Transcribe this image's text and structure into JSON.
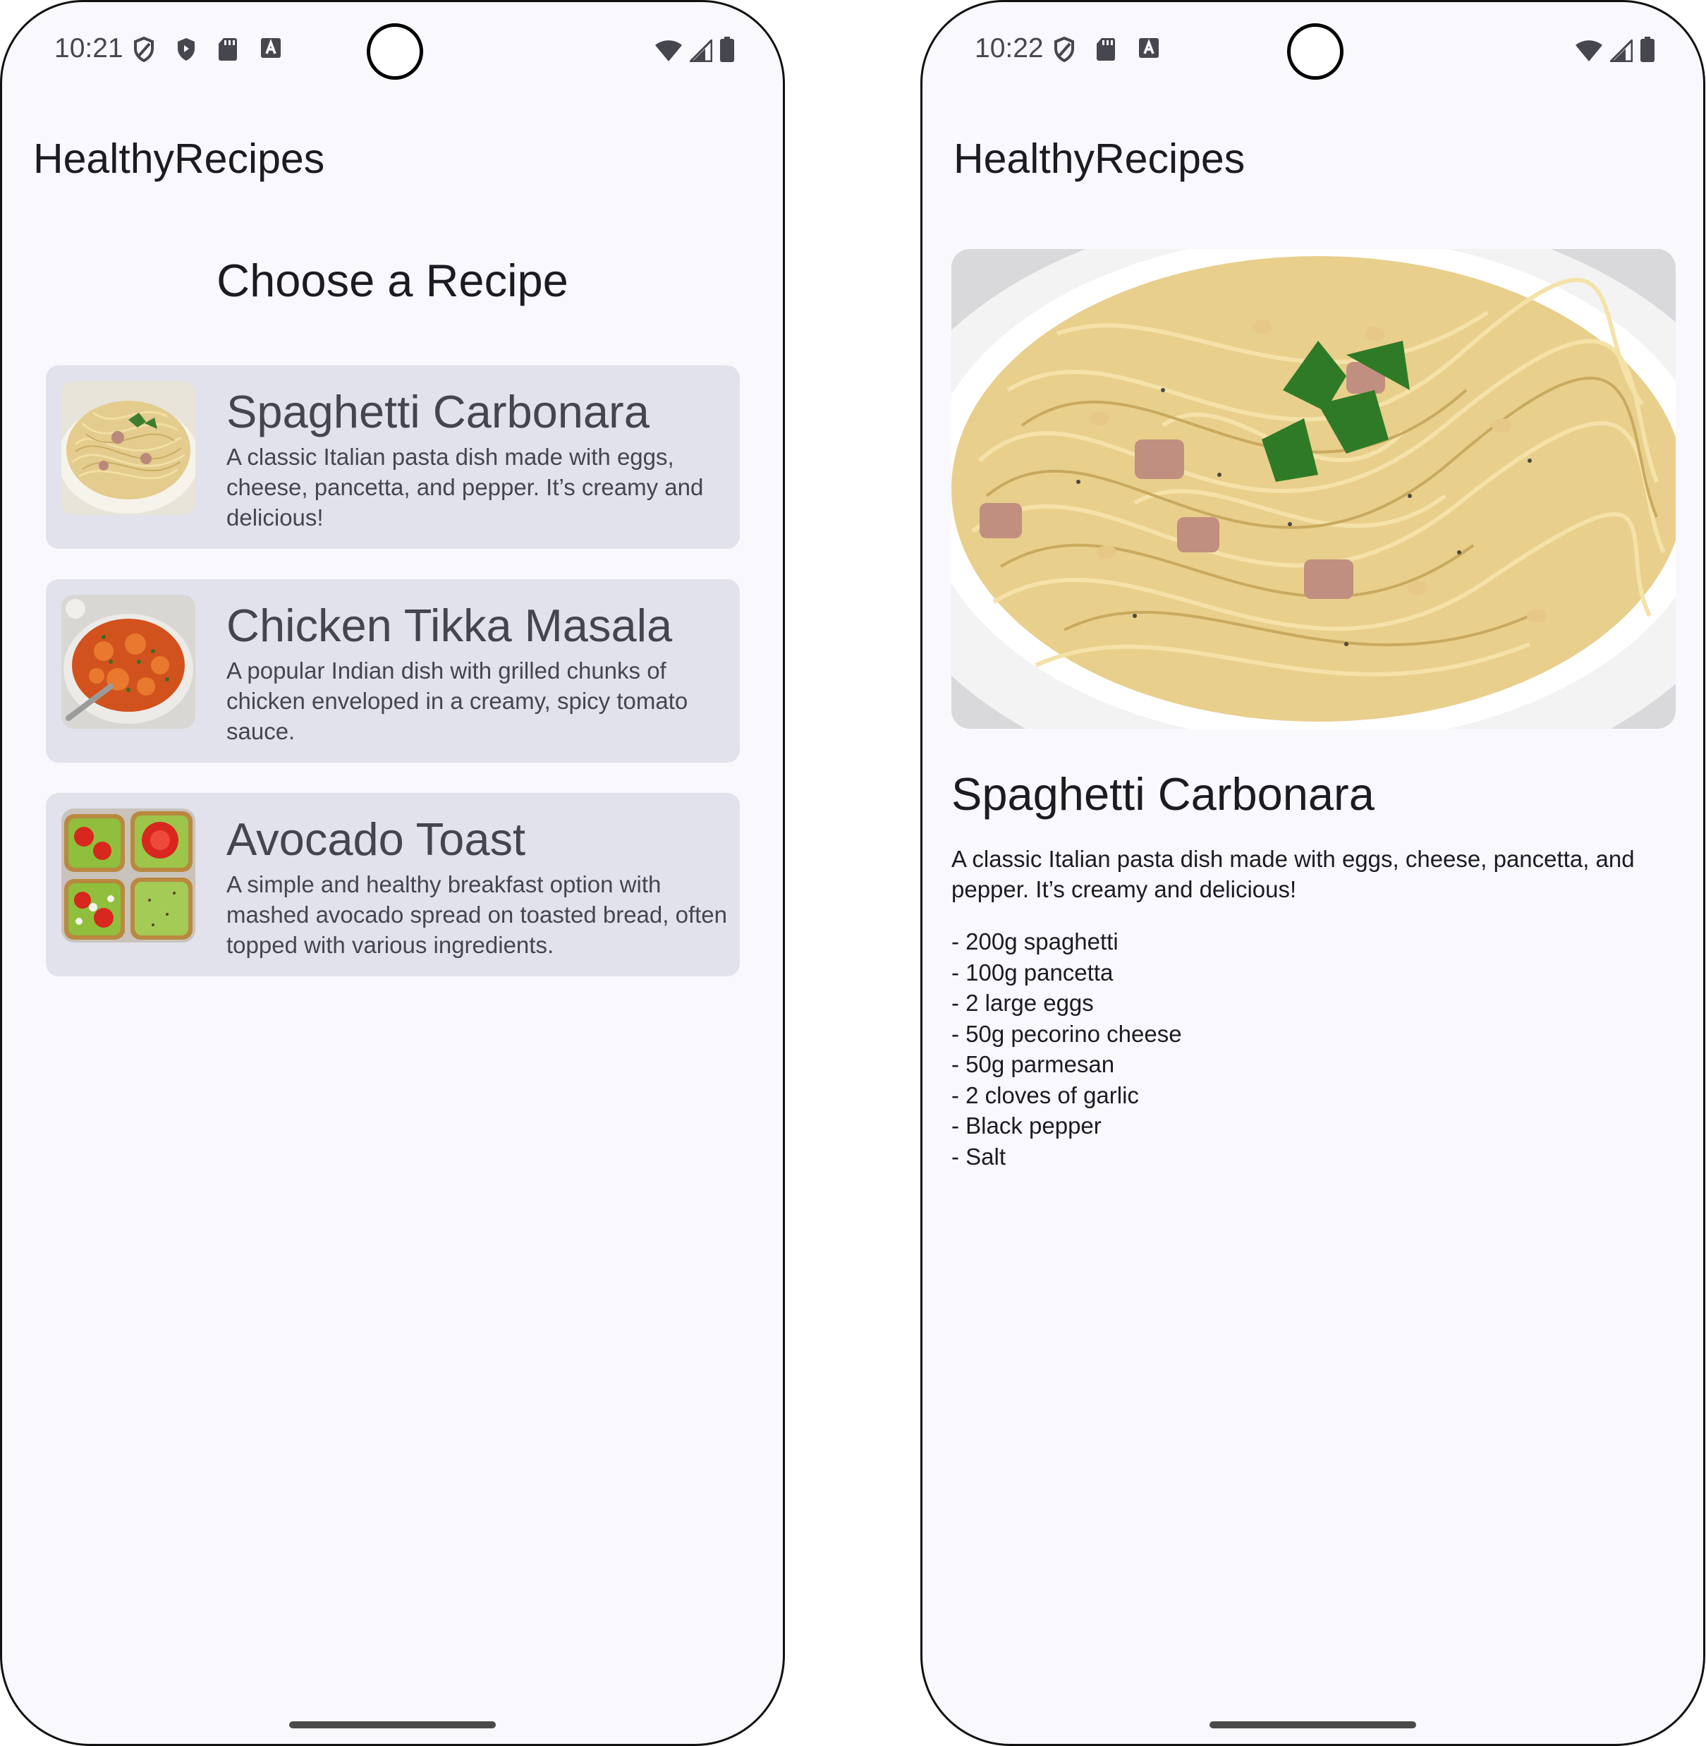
{
  "left_screen": {
    "status_bar": {
      "time": "10:21",
      "icons": [
        "shield-outline-icon",
        "shield-filled-icon",
        "sd-card-icon",
        "keyboard-a-icon",
        "wifi-icon",
        "cellular-signal-icon",
        "battery-icon"
      ]
    },
    "app_title": "HealthyRecipes",
    "list_title": "Choose a Recipe",
    "recipes": [
      {
        "title": "Spaghetti Carbonara",
        "description": "A classic Italian pasta dish made with eggs, cheese, pancetta, and pepper. It’s creamy and delicious!",
        "image": "spaghetti-carbonara-photo"
      },
      {
        "title": "Chicken Tikka Masala",
        "description": "A popular Indian dish with grilled chunks of chicken enveloped in a creamy, spicy tomato sauce.",
        "image": "chicken-tikka-masala-photo"
      },
      {
        "title": "Avocado Toast",
        "description": "A simple and healthy breakfast option with mashed avocado spread on toasted bread, often topped with various ingredients.",
        "image": "avocado-toast-photo"
      }
    ]
  },
  "right_screen": {
    "status_bar": {
      "time": "10:22",
      "icons": [
        "shield-outline-icon",
        "sd-card-icon",
        "keyboard-a-icon",
        "wifi-icon",
        "cellular-signal-icon",
        "battery-icon"
      ]
    },
    "app_title": "HealthyRecipes",
    "detail": {
      "image": "spaghetti-carbonara-photo",
      "title": "Spaghetti Carbonara",
      "description": "A classic Italian pasta dish made with eggs, cheese, pancetta, and pepper. It’s creamy and delicious!",
      "ingredients": [
        "- 200g spaghetti",
        "- 100g pancetta",
        "- 2 large eggs",
        "- 50g pecorino cheese",
        "- 50g parmesan",
        "- 2 cloves of garlic",
        "- Black pepper",
        "- Salt"
      ]
    }
  },
  "colors": {
    "screen_background": "#f8f8fd",
    "card_background": "#e2e2ec",
    "card_text": "#44464f",
    "primary_text": "#1b1b21",
    "status_icons": "#46464f"
  }
}
